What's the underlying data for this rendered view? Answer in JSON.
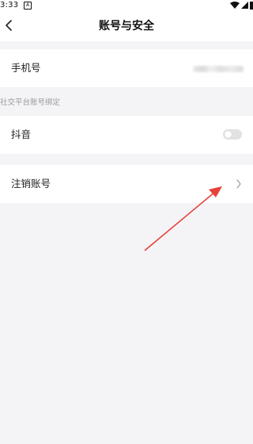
{
  "status_bar": {
    "time": "3:33",
    "notification_glyph": "A",
    "icons": [
      "wifi-icon",
      "signal-icon",
      "battery-icon"
    ]
  },
  "header": {
    "title": "账号与安全",
    "back_icon": "chevron-left-icon"
  },
  "rows": {
    "phone": {
      "label": "手机号",
      "value_masked": true
    },
    "douyin": {
      "label": "抖音",
      "toggle_on": false
    },
    "cancel": {
      "label": "注销账号",
      "icon": "chevron-right-icon"
    }
  },
  "section": {
    "social_binding_label": "社交平台账号绑定"
  },
  "colors": {
    "background": "#f4f4f6",
    "card": "#ffffff",
    "text": "#222222",
    "muted": "#9a9a9a",
    "toggle_off": "#e2e2e2",
    "annotation_arrow": "#e8413a"
  }
}
